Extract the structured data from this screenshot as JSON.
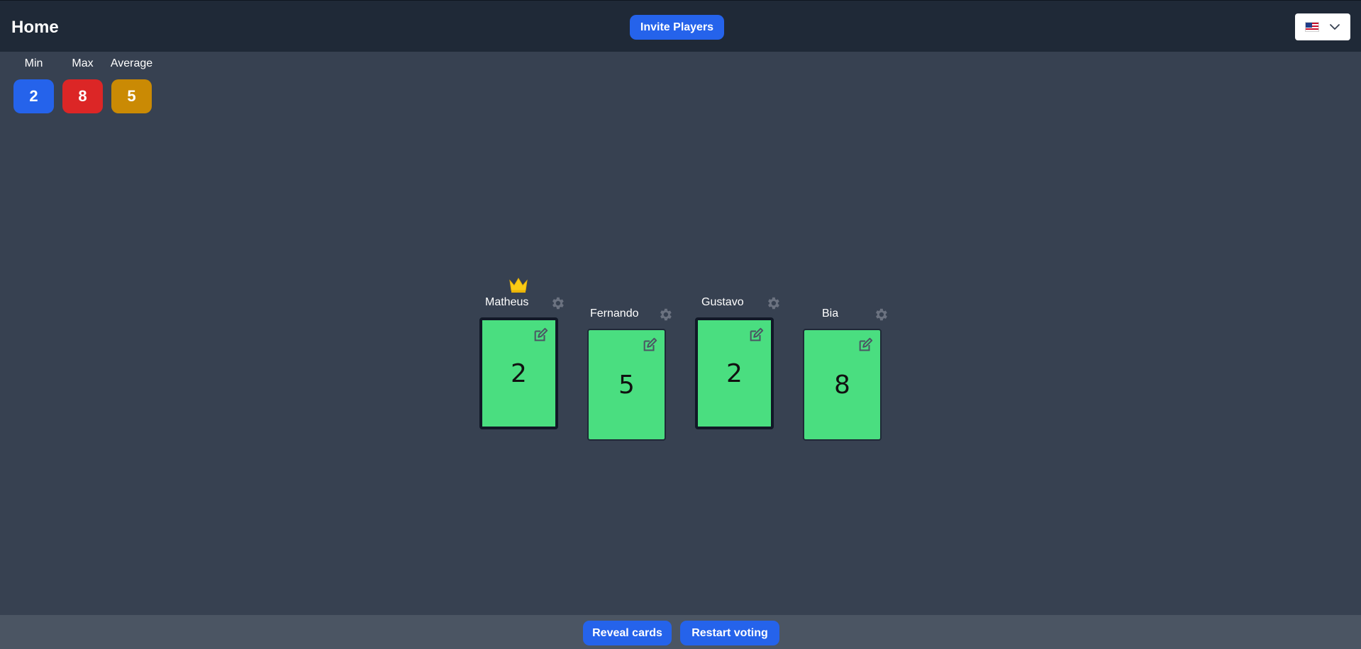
{
  "header": {
    "title": "Home",
    "invite_label": "Invite Players",
    "language": {
      "icon": "us-flag-icon",
      "selected": "en-US"
    }
  },
  "stats": {
    "min": {
      "label": "Min",
      "value": "2",
      "color": "#2563eb"
    },
    "max": {
      "label": "Max",
      "value": "8",
      "color": "#dc2626"
    },
    "average": {
      "label": "Average",
      "value": "5",
      "color": "#ca8a04"
    }
  },
  "players": [
    {
      "name": "Matheus",
      "vote": "2",
      "is_owner": true,
      "card_selected": true
    },
    {
      "name": "Fernando",
      "vote": "5",
      "is_owner": false,
      "card_selected": false
    },
    {
      "name": "Gustavo",
      "vote": "2",
      "is_owner": false,
      "card_selected": true
    },
    {
      "name": "Bia",
      "vote": "8",
      "is_owner": false,
      "card_selected": false
    }
  ],
  "footer": {
    "reveal_label": "Reveal cards",
    "restart_label": "Restart voting"
  },
  "colors": {
    "card": "#4ade80",
    "accent": "#2563eb",
    "crown": "#facc15",
    "gear": "#6b7280"
  }
}
